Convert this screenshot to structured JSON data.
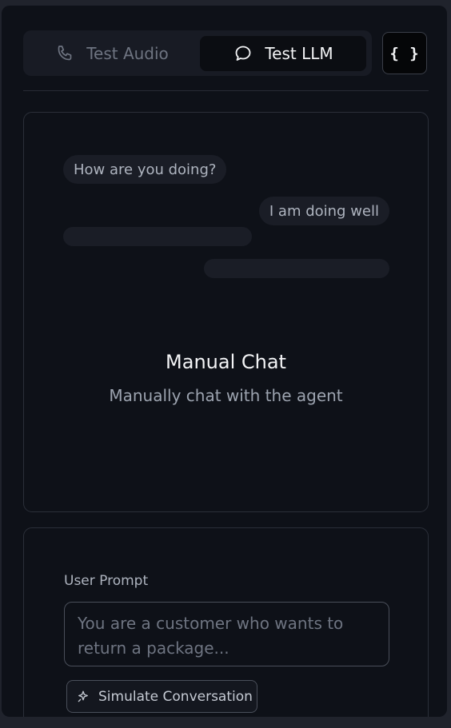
{
  "tabs": {
    "audio": {
      "label": "Test Audio",
      "icon": "phone-icon",
      "active": false
    },
    "llm": {
      "label": "Test LLM",
      "icon": "chat-bubble-icon",
      "active": true
    }
  },
  "json_button": {
    "label": "{ }",
    "icon": "braces-icon"
  },
  "chat_preview": {
    "user_message": "How are you doing?",
    "agent_message": "I am doing well",
    "title": "Manual Chat",
    "subtitle": "Manually chat with the agent"
  },
  "simulation": {
    "prompt_label": "User Prompt",
    "prompt_placeholder": "You are a customer who wants to return a package...",
    "prompt_value": "",
    "button_label": "Simulate Conversation",
    "button_icon": "sparkle-icon"
  },
  "colors": {
    "background": "#0e1118",
    "active_tab": "#0b0d12",
    "bubble": "#1a1d26",
    "text_primary": "#f3f4f6",
    "text_muted": "#9ca3af"
  }
}
